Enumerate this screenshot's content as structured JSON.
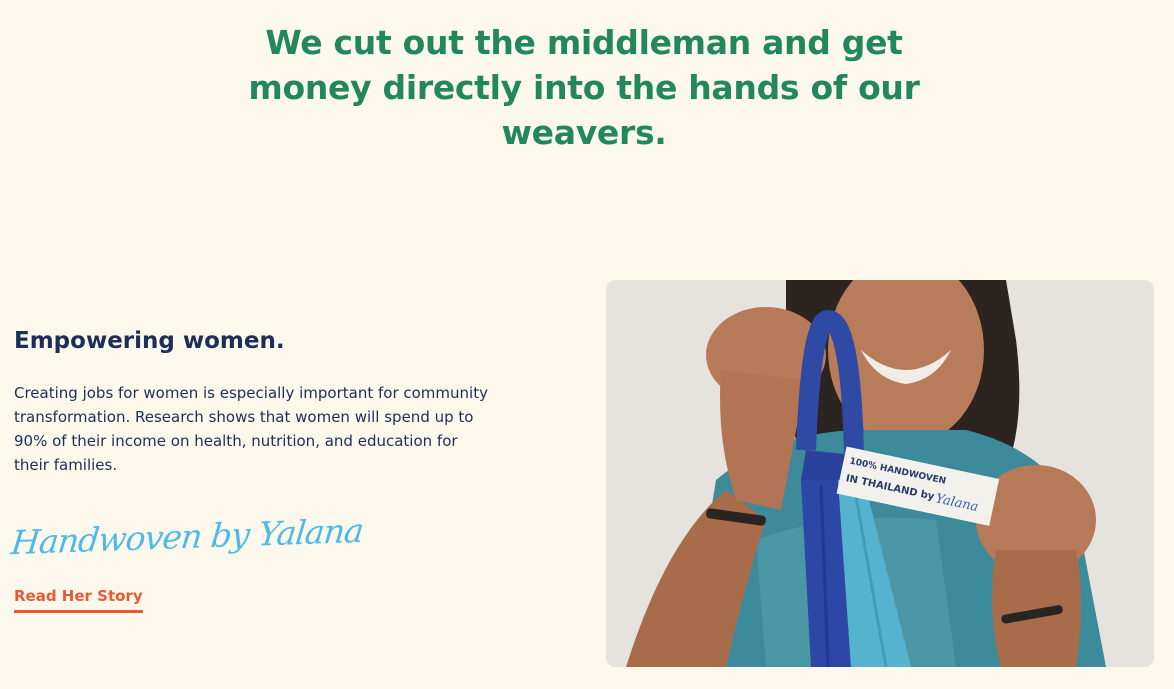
{
  "headline": "We cut out the middleman and get money directly into the hands of our weavers.",
  "feature": {
    "title": "Empowering women.",
    "body": "Creating jobs for women is especially important for community transformation. Research shows that women will spend up to 90% of their income on health, nutrition, and education for their families.",
    "signature": "Handwoven by Yalana",
    "link_label": "Read Her Story"
  },
  "photo": {
    "tag_line1": "100% HANDWOVEN",
    "tag_line2": "IN THAILAND by",
    "tag_signature": "Yalana"
  },
  "colors": {
    "background": "#fcf8ec",
    "headline": "#22875f",
    "title": "#1d2d5c",
    "signature": "#4cbbe8",
    "link": "#e55b34"
  }
}
